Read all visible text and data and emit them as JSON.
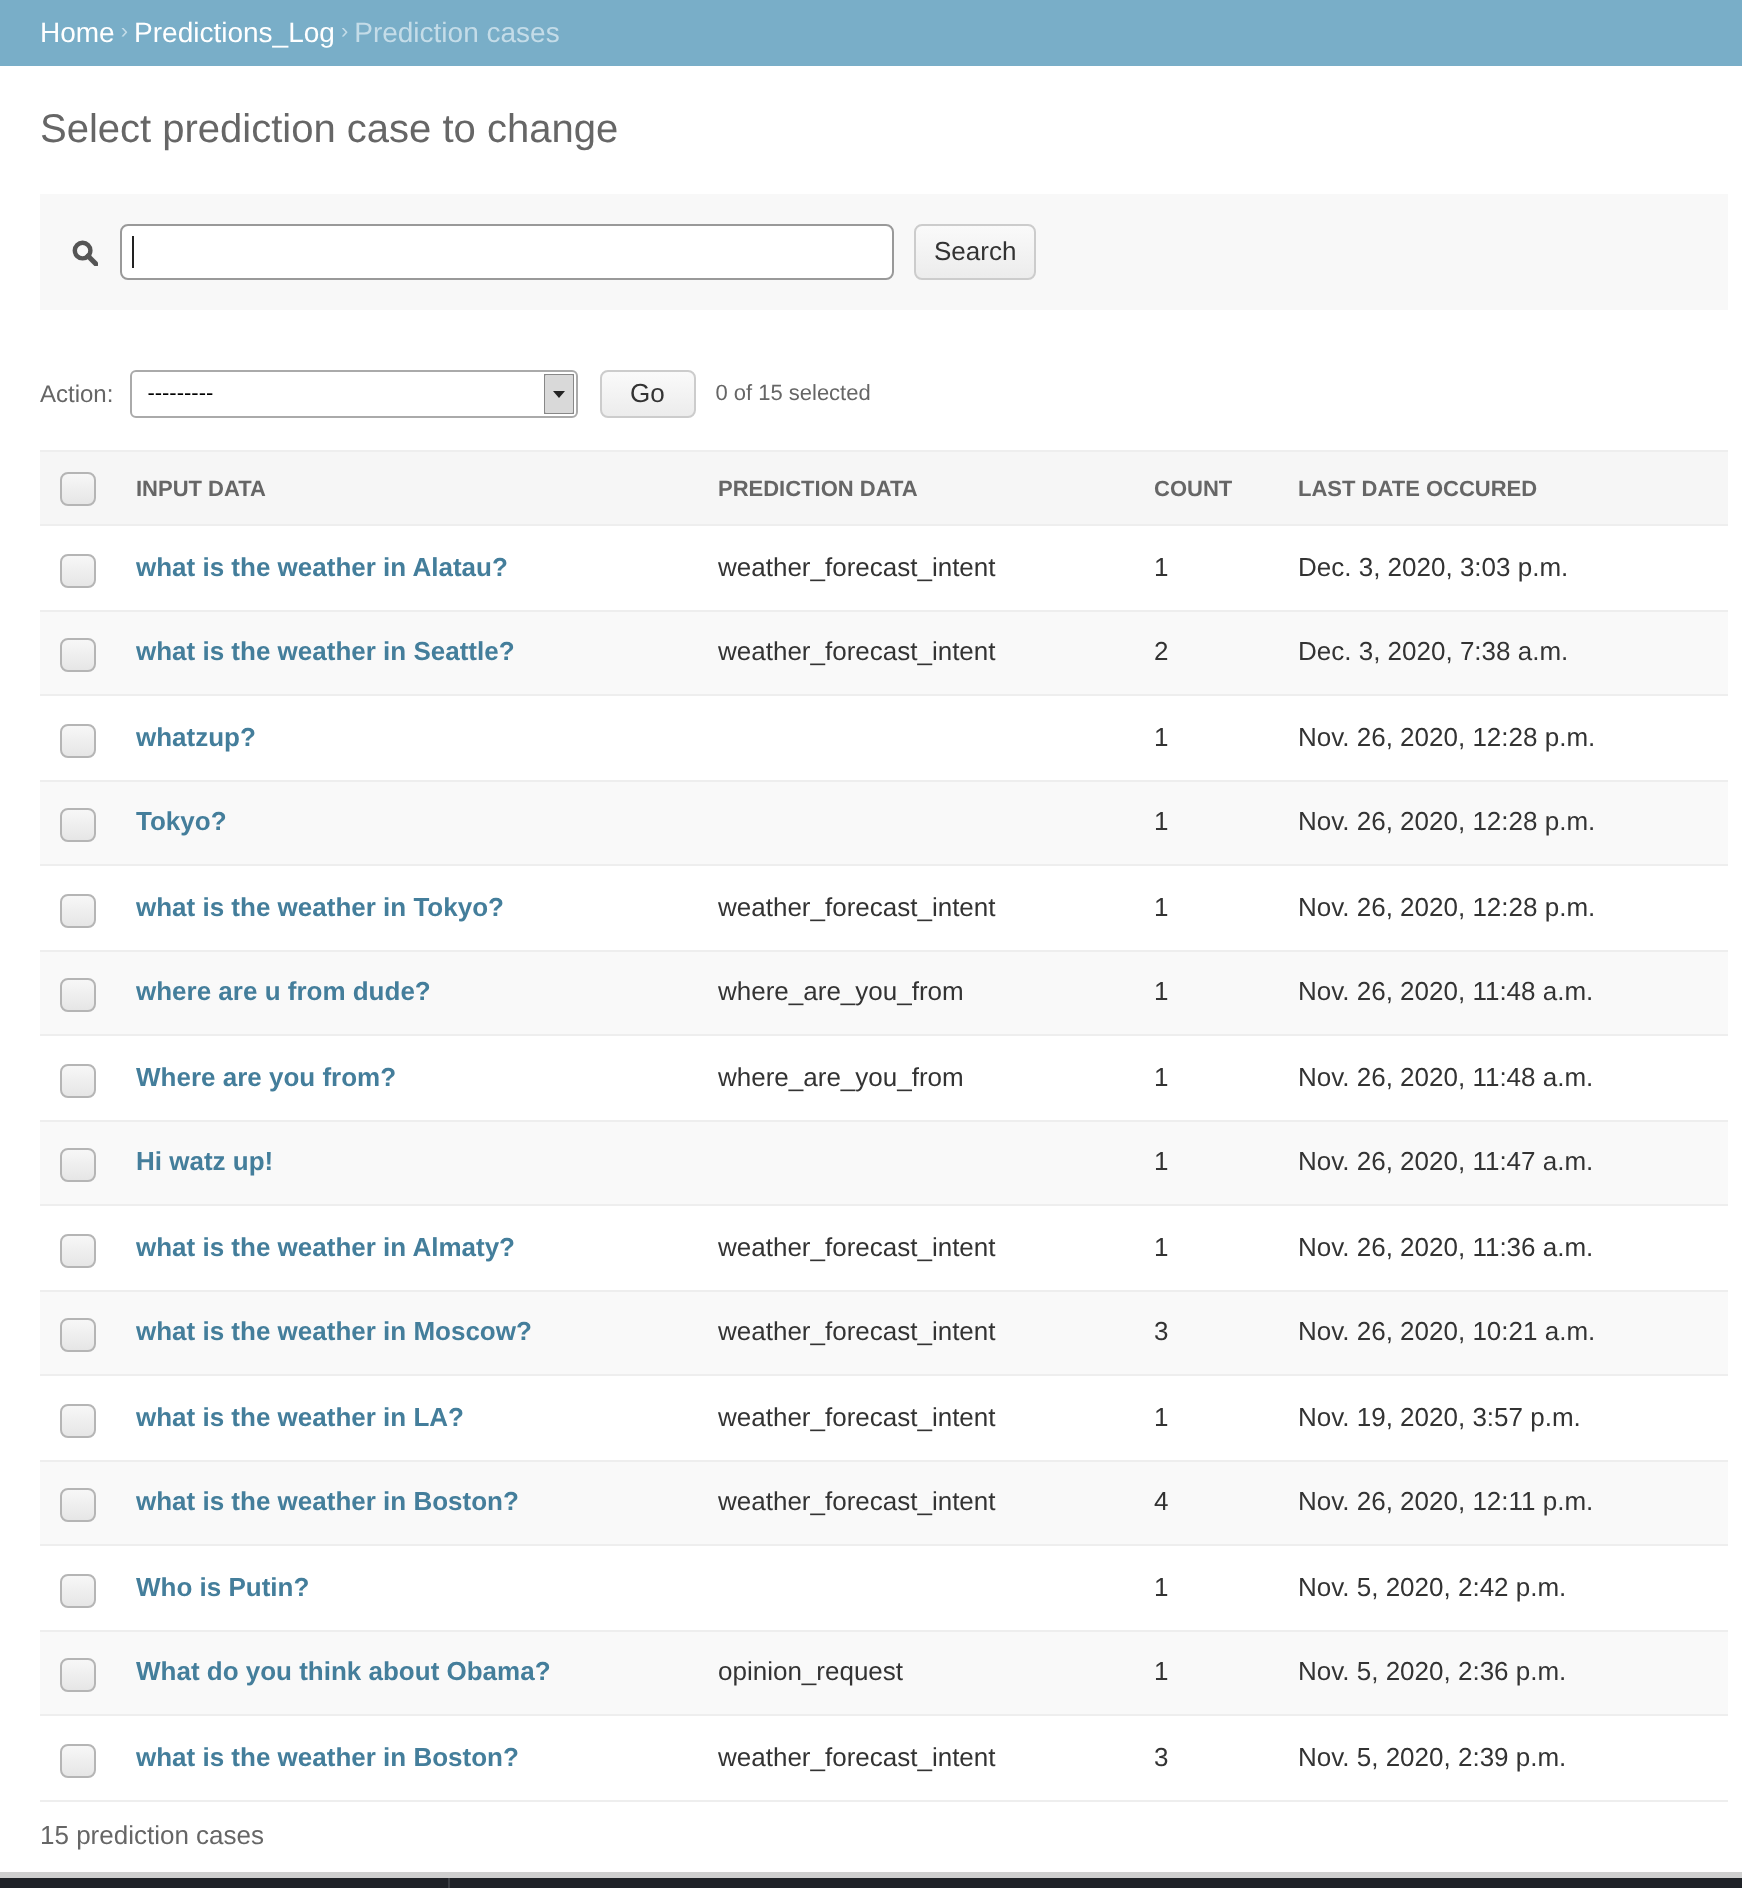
{
  "breadcrumbs": [
    {
      "kind": "link",
      "text": "Home"
    },
    {
      "kind": "separator",
      "text": "›"
    },
    {
      "kind": "link",
      "text": "Predictions_Log"
    },
    {
      "kind": "separator",
      "text": "›"
    },
    {
      "kind": "current",
      "text": "Prediction cases"
    }
  ],
  "title": "Select prediction case to change",
  "search": {
    "focused": true,
    "button": "Search"
  },
  "actions": {
    "label": "Action:",
    "select_value": "---------",
    "button": "Go",
    "selection_count": "0 of 15 selected"
  },
  "table": {
    "select_all": {
      "checked": false
    },
    "columns": [
      "INPUT DATA",
      "PREDICTION DATA",
      "COUNT",
      "LAST DATE OCCURED"
    ],
    "rows": [
      {
        "checked": false,
        "input_data": "what is the weather in Alatau?",
        "prediction_data": "weather_forecast_intent",
        "count": "1",
        "last_date": "Dec. 3, 2020, 3:03 p.m."
      },
      {
        "checked": false,
        "input_data": "what is the weather in Seattle?",
        "prediction_data": "weather_forecast_intent",
        "count": "2",
        "last_date": "Dec. 3, 2020, 7:38 a.m."
      },
      {
        "checked": false,
        "input_data": "whatzup?",
        "count": "1",
        "last_date": "Nov. 26, 2020, 12:28 p.m."
      },
      {
        "checked": false,
        "input_data": "Tokyo?",
        "count": "1",
        "last_date": "Nov. 26, 2020, 12:28 p.m."
      },
      {
        "checked": false,
        "input_data": "what is the weather in Tokyo?",
        "prediction_data": "weather_forecast_intent",
        "count": "1",
        "last_date": "Nov. 26, 2020, 12:28 p.m."
      },
      {
        "checked": false,
        "input_data": "where are u from dude?",
        "prediction_data": "where_are_you_from",
        "count": "1",
        "last_date": "Nov. 26, 2020, 11:48 a.m."
      },
      {
        "checked": false,
        "input_data": "Where are you from?",
        "prediction_data": "where_are_you_from",
        "count": "1",
        "last_date": "Nov. 26, 2020, 11:48 a.m."
      },
      {
        "checked": false,
        "input_data": "Hi watz up!",
        "count": "1",
        "last_date": "Nov. 26, 2020, 11:47 a.m."
      },
      {
        "checked": false,
        "input_data": "what is the weather in Almaty?",
        "prediction_data": "weather_forecast_intent",
        "count": "1",
        "last_date": "Nov. 26, 2020, 11:36 a.m."
      },
      {
        "checked": false,
        "input_data": "what is the weather in Moscow?",
        "prediction_data": "weather_forecast_intent",
        "count": "3",
        "last_date": "Nov. 26, 2020, 10:21 a.m."
      },
      {
        "checked": false,
        "input_data": "what is the weather in LA?",
        "prediction_data": "weather_forecast_intent",
        "count": "1",
        "last_date": "Nov. 19, 2020, 3:57 p.m."
      },
      {
        "checked": false,
        "input_data": "what is the weather in Boston?",
        "prediction_data": "weather_forecast_intent",
        "count": "4",
        "last_date": "Nov. 26, 2020, 12:11 p.m."
      },
      {
        "checked": false,
        "input_data": "Who is Putin?",
        "count": "1",
        "last_date": "Nov. 5, 2020, 2:42 p.m."
      },
      {
        "checked": false,
        "input_data": "What do you think about Obama?",
        "prediction_data": "opinion_request",
        "count": "1",
        "last_date": "Nov. 5, 2020, 2:36 p.m."
      },
      {
        "checked": false,
        "input_data": "what is the weather in Boston?",
        "prediction_data": "weather_forecast_intent",
        "count": "3",
        "last_date": "Nov. 5, 2020, 2:39 p.m."
      }
    ]
  },
  "footer": "15 prediction cases"
}
